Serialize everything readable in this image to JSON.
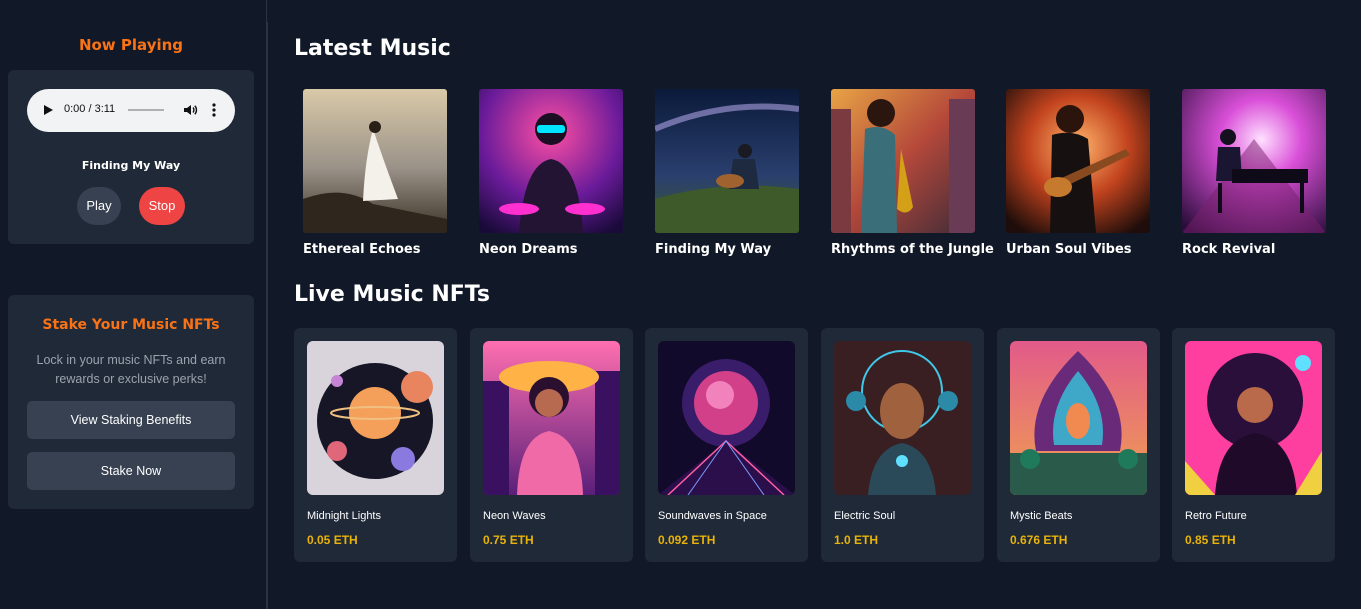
{
  "sidebar": {
    "now_playing_title": "Now Playing",
    "audio": {
      "time": "0:00 / 3:11",
      "progress": 0
    },
    "track_title": "Finding My Way",
    "play_label": "Play",
    "stop_label": "Stop",
    "stake_title": "Stake Your Music NFTs",
    "stake_description": "Lock in your music NFTs and earn rewards or exclusive perks!",
    "view_benefits_label": "View Staking Benefits",
    "stake_now_label": "Stake Now"
  },
  "latest_music": {
    "title": "Latest Music",
    "items": [
      {
        "label": "Ethereal Echoes"
      },
      {
        "label": "Neon Dreams"
      },
      {
        "label": "Finding My Way"
      },
      {
        "label": "Rhythms of the Jungle"
      },
      {
        "label": "Urban Soul Vibes"
      },
      {
        "label": "Rock Revival"
      }
    ]
  },
  "live_nfts": {
    "title": "Live Music NFTs",
    "items": [
      {
        "name": "Midnight Lights",
        "price": "0.05 ETH"
      },
      {
        "name": "Neon Waves",
        "price": "0.75 ETH"
      },
      {
        "name": "Soundwaves in Space",
        "price": "0.092 ETH"
      },
      {
        "name": "Electric Soul",
        "price": "1.0 ETH"
      },
      {
        "name": "Mystic Beats",
        "price": "0.676 ETH"
      },
      {
        "name": "Retro Future",
        "price": "0.85 ETH"
      }
    ]
  },
  "colors": {
    "background": "#111827",
    "card": "#1f2937",
    "accent": "#f97316",
    "price": "#eab308",
    "stop": "#ef4444",
    "button": "#374151"
  }
}
